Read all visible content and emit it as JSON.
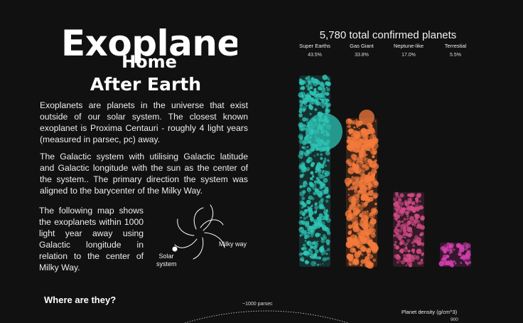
{
  "title": "Exoplanet",
  "subtitle_line1": "Home",
  "subtitle_line2": "After Earth",
  "paragraphs": [
    "Exoplanets are planets in the universe that exist outside of our solar system. The closest known exoplanet is Proxima Centauri - roughly 4 light years (measured in parsec, pc) away.",
    "The Galactic system with utilising Galactic latitude and Galactic longitude with the sun as the center of the system.. The primary direction the system was aligned to the barycenter of the Milky Way.",
    "The following map shows the exoplanets within 1000 light year away using Galactic longitude in relation to the center of Milky Way."
  ],
  "galaxy_legend": {
    "solar_label_line1": "Solar",
    "solar_label_line2": "system",
    "milky_label": "Milky way",
    "colors": {
      "stroke": "#ffffff"
    }
  },
  "section_heading": "Where are they?",
  "map": {
    "parsec_label": "~1000 parsec",
    "density_label": "Planet density (g/cm^3)",
    "density_value": "900"
  },
  "chart_data": {
    "type": "bar",
    "title": "5,780 total confirmed planets",
    "categories": [
      "Super Earths",
      "Gas Giant",
      "Neptune-like",
      "Terrestial"
    ],
    "value_labels": [
      "43.5%",
      "33.8%",
      "17.0%",
      "5.5%"
    ],
    "values": [
      43.5,
      33.8,
      17.0,
      5.5
    ],
    "colors": [
      "#2ec4b6",
      "#f47a3c",
      "#d14a86",
      "#d63fb0"
    ],
    "ylim": [
      0,
      45
    ]
  }
}
